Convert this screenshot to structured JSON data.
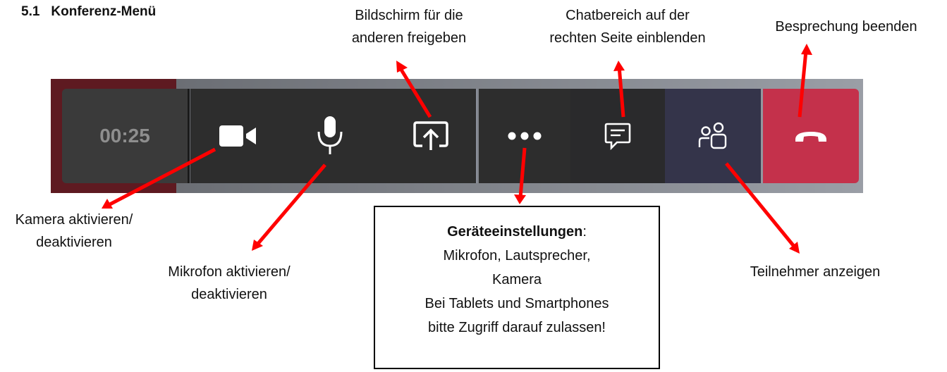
{
  "heading": {
    "number": "5.1",
    "title": "Konferenz-Menü"
  },
  "toolbar": {
    "timer": "00:25",
    "icons": [
      "camera-icon",
      "microphone-icon",
      "share-screen-icon",
      "more-options-icon",
      "chat-icon",
      "participants-icon",
      "hang-up-icon"
    ],
    "colors": {
      "end_call": "#c4314b",
      "dark": "#2d2d2d",
      "participants_bg": "#34344a"
    }
  },
  "annotations": {
    "share_line1": "Bildschirm für die",
    "share_line2": "anderen freigeben",
    "chat_line1": "Chatbereich auf der",
    "chat_line2": "rechten Seite einblenden",
    "end_call": "Besprechung beenden",
    "camera_line1": "Kamera aktivieren/",
    "camera_line2": "deaktivieren",
    "mic_line1": "Mikrofon aktivieren/",
    "mic_line2": "deaktivieren",
    "participants": "Teilnehmer anzeigen"
  },
  "device_settings": {
    "title": "Geräteeinstellungen",
    "title_suffix": ":",
    "line1": "Mikrofon, Lautsprecher,",
    "line2": "Kamera",
    "line3": "Bei Tablets und Smartphones",
    "line4": "bitte Zugriff darauf zulassen!"
  },
  "colors": {
    "arrow": "#ff0000"
  }
}
